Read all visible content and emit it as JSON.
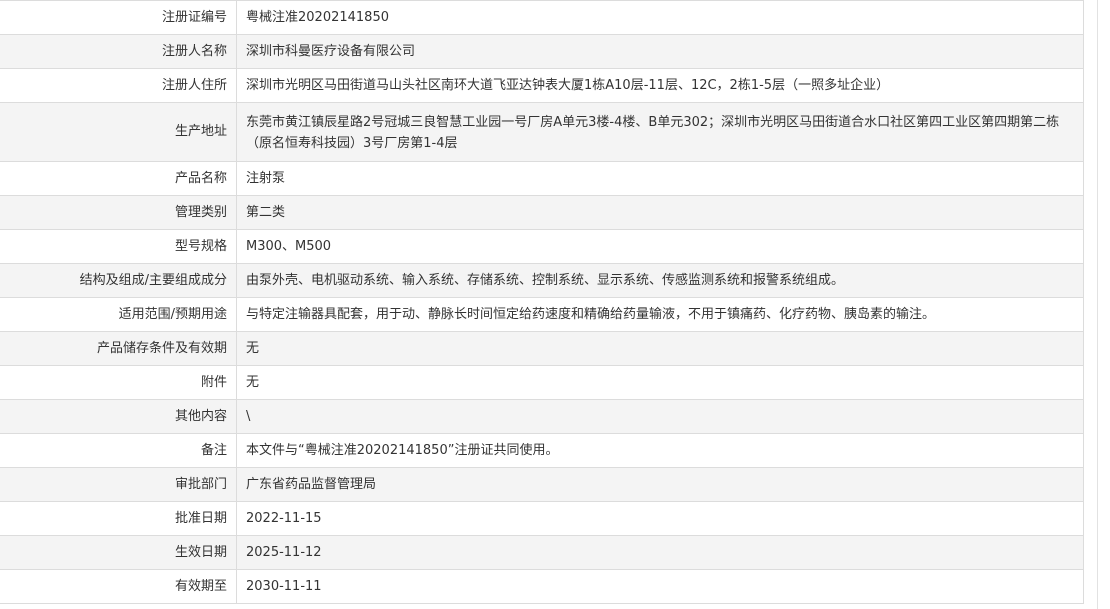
{
  "record": {
    "rows": [
      {
        "label": "注册证编号",
        "value": "粤械注准20202141850"
      },
      {
        "label": "注册人名称",
        "value": "深圳市科曼医疗设备有限公司"
      },
      {
        "label": "注册人住所",
        "value": "深圳市光明区马田街道马山头社区南环大道飞亚达钟表大厦1栋A10层-11层、12C，2栋1-5层（一照多址企业）"
      },
      {
        "label": "生产地址",
        "value": "东莞市黄江镇辰星路2号冠城三良智慧工业园一号厂房A单元3楼-4楼、B单元302；深圳市光明区马田街道合水口社区第四工业区第四期第二栋（原名恒寿科技园）3号厂房第1-4层"
      },
      {
        "label": "产品名称",
        "value": "注射泵"
      },
      {
        "label": "管理类别",
        "value": "第二类"
      },
      {
        "label": "型号规格",
        "value": "M300、M500"
      },
      {
        "label": "结构及组成/主要组成成分",
        "value": "由泵外壳、电机驱动系统、输入系统、存储系统、控制系统、显示系统、传感监测系统和报警系统组成。"
      },
      {
        "label": "适用范围/预期用途",
        "value": "与特定注输器具配套，用于动、静脉长时间恒定给药速度和精确给药量输液，不用于镇痛药、化疗药物、胰岛素的输注。"
      },
      {
        "label": "产品储存条件及有效期",
        "value": "无"
      },
      {
        "label": "附件",
        "value": "无"
      },
      {
        "label": "其他内容",
        "value": "\\"
      },
      {
        "label": "备注",
        "value": "本文件与“粤械注准20202141850”注册证共同使用。"
      },
      {
        "label": "审批部门",
        "value": "广东省药品监督管理局"
      },
      {
        "label": "批准日期",
        "value": "2022-11-15"
      },
      {
        "label": "生效日期",
        "value": "2025-11-12"
      },
      {
        "label": "有效期至",
        "value": "2030-11-11"
      }
    ]
  }
}
